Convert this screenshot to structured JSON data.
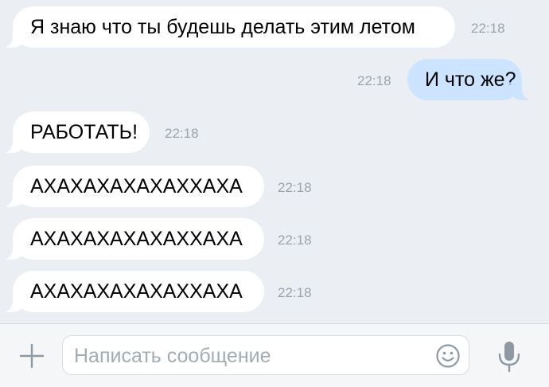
{
  "messages": [
    {
      "side": "in",
      "text": "Я знаю что ты будешь делать этим летом",
      "time": "22:18"
    },
    {
      "side": "out",
      "text": "И что же?",
      "time": "22:18"
    },
    {
      "side": "in",
      "text": "РАБОТАТЬ!",
      "time": "22:18"
    },
    {
      "side": "in",
      "text": "АХАХАХАХАХАХХАХА",
      "time": "22:18"
    },
    {
      "side": "in",
      "text": "АХАХАХАХАХАХХАХА",
      "time": "22:18"
    },
    {
      "side": "in",
      "text": "АХАХАХАХАХАХХАХА",
      "time": "22:18"
    }
  ],
  "composer": {
    "placeholder": "Написать сообщение",
    "value": "",
    "attach_icon": "plus-icon",
    "emoji_icon": "smile-icon",
    "voice_icon": "microphone-icon"
  },
  "colors": {
    "background": "#ebeff4",
    "incoming_bubble": "#ffffff",
    "outgoing_bubble": "#cce4ff",
    "timestamp": "#9aa3ad",
    "icon": "#8f99a3"
  }
}
